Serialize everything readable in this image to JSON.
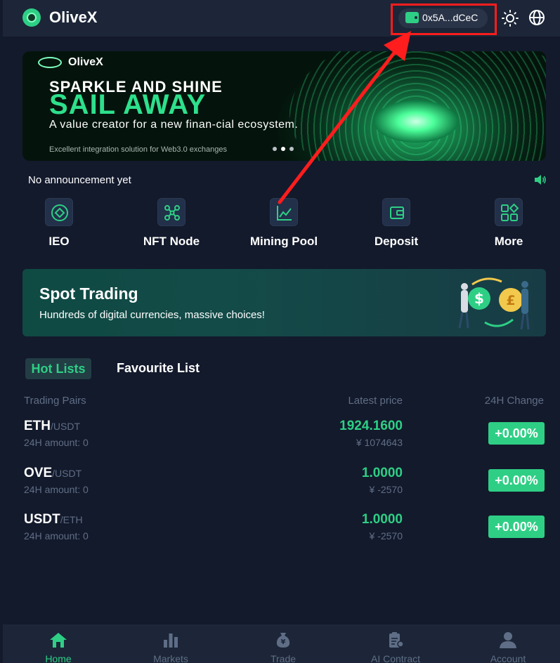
{
  "header": {
    "brand": "OliveX",
    "wallet_address": "0x5A...dCeC",
    "icons": {
      "logo": "olivex-logo-icon",
      "wallet": "wallet-icon",
      "theme": "sun-icon",
      "language": "globe-icon"
    }
  },
  "banner": {
    "logo_text": "OliveX",
    "headline": "SPARKLE AND SHINE",
    "headline_accent": "SAIL AWAY",
    "subtitle": "A value creator for a new finan-cial ecosystem.",
    "small_text": "Excellent integration solution for Web3.0 exchanges",
    "active_slide": 2,
    "slide_count": 3
  },
  "announcement": {
    "text": "No announcement yet"
  },
  "quick_nav": [
    {
      "label": "IEO",
      "icon": "diamond-icon"
    },
    {
      "label": "NFT Node",
      "icon": "network-node-icon"
    },
    {
      "label": "Mining Pool",
      "icon": "chart-trend-icon"
    },
    {
      "label": "Deposit",
      "icon": "wallet-icon"
    },
    {
      "label": "More",
      "icon": "grid-icon"
    }
  ],
  "spot": {
    "title": "Spot Trading",
    "subtitle": "Hundreds of digital currencies, massive choices!"
  },
  "tabs": {
    "hot": "Hot Lists",
    "favourite": "Favourite List"
  },
  "table": {
    "headers": {
      "pair": "Trading Pairs",
      "price": "Latest price",
      "change": "24H Change"
    },
    "rows": [
      {
        "base": "ETH",
        "quote": "/USDT",
        "amount": "24H amount: 0",
        "price": "1924.1600",
        "cny": "¥ 1074643",
        "change": "+0.00%"
      },
      {
        "base": "OVE",
        "quote": "/USDT",
        "amount": "24H amount: 0",
        "price": "1.0000",
        "cny": "¥ -2570",
        "change": "+0.00%"
      },
      {
        "base": "USDT",
        "quote": "/ETH",
        "amount": "24H amount: 0",
        "price": "1.0000",
        "cny": "¥ -2570",
        "change": "+0.00%"
      }
    ]
  },
  "bottom_nav": [
    {
      "label": "Home",
      "icon": "home-icon",
      "active": true
    },
    {
      "label": "Markets",
      "icon": "bar-chart-icon",
      "active": false
    },
    {
      "label": "Trade",
      "icon": "money-bag-icon",
      "active": false
    },
    {
      "label": "AI Contract",
      "icon": "contract-icon",
      "active": false
    },
    {
      "label": "Account",
      "icon": "user-icon",
      "active": false
    }
  ],
  "colors": {
    "accent": "#2ecf85",
    "background": "#131a2c",
    "header": "#1c2638",
    "muted": "#5f6e86",
    "highlight": "#ff1d1d"
  }
}
